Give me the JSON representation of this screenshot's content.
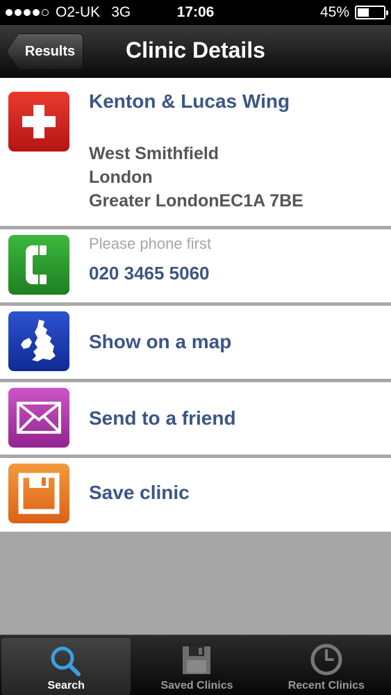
{
  "status_bar": {
    "carrier": "O2-UK",
    "network": "3G",
    "time": "17:06",
    "battery_text": "45%",
    "battery_level": 0.45,
    "signal_bars": 4
  },
  "nav": {
    "back_label": "Results",
    "title": "Clinic Details"
  },
  "clinic": {
    "name": "Kenton & Lucas Wing",
    "address_line1": "West Smithfield",
    "address_line2": "London",
    "address_line3": "Greater LondonEC1A 7BE",
    "icon": "red-cross-icon"
  },
  "phone": {
    "hint": "Please phone first",
    "number": "020 3465 5060",
    "icon": "phone-icon"
  },
  "actions": {
    "map_label": "Show on a map",
    "map_icon": "uk-map-icon",
    "send_label": "Send to a friend",
    "send_icon": "envelope-icon",
    "save_label": "Save clinic",
    "save_icon": "floppy-disk-icon"
  },
  "tabs": [
    {
      "label": "Search",
      "icon": "search-icon",
      "active": true
    },
    {
      "label": "Saved Clinics",
      "icon": "floppy-disk-icon",
      "active": false
    },
    {
      "label": "Recent Clinics",
      "icon": "clock-icon",
      "active": false
    }
  ],
  "colors": {
    "accent_text": "#3b5685",
    "clinic_icon": "#d9211f",
    "phone_icon": "#2d9a2f",
    "map_icon": "#1a3eb5",
    "send_icon": "#b53cb2",
    "save_icon": "#ea7e22",
    "tab_active_icon": "#3aa0e0"
  }
}
